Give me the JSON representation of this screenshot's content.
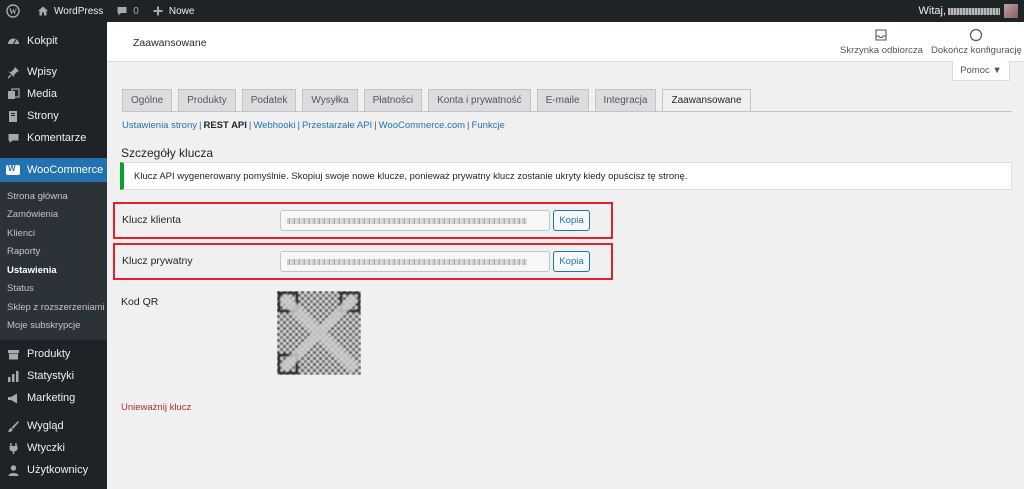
{
  "admin_bar": {
    "site_name": "WordPress",
    "comments_count": "0",
    "new_label": "Nowe",
    "greeting": "Witaj,"
  },
  "sidebar": {
    "top_items": [
      {
        "label": "Kokpit",
        "icon": "dashboard-icon"
      },
      {
        "label": "Wpisy",
        "icon": "pin-icon"
      },
      {
        "label": "Media",
        "icon": "media-icon"
      },
      {
        "label": "Strony",
        "icon": "page-icon"
      },
      {
        "label": "Komentarze",
        "icon": "comment-icon"
      }
    ],
    "woocommerce_label": "WooCommerce",
    "submenu": [
      "Strona główna",
      "Zamówienia",
      "Klienci",
      "Raporty",
      "Ustawienia",
      "Status",
      "Sklep z rozszerzeniami",
      "Moje subskrypcje"
    ],
    "bottom_items": [
      {
        "label": "Produkty",
        "icon": "archive-icon"
      },
      {
        "label": "Statystyki",
        "icon": "bar-chart-icon"
      },
      {
        "label": "Marketing",
        "icon": "megaphone-icon"
      },
      {
        "label": "Wygląd",
        "icon": "brush-icon"
      },
      {
        "label": "Wtyczki",
        "icon": "plug-icon"
      },
      {
        "label": "Użytkownicy",
        "icon": "user-icon"
      }
    ]
  },
  "header": {
    "title": "Zaawansowane",
    "inbox_label": "Skrzynka odbiorcza",
    "setup_label": "Dokończ konfigurację",
    "help_label": "Pomoc ▼"
  },
  "tabs": [
    "Ogólne",
    "Produkty",
    "Podatek",
    "Wysyłka",
    "Płatności",
    "Konta i prywatność",
    "E-maile",
    "Integracja",
    "Zaawansowane"
  ],
  "subnav": [
    "Ustawienia strony",
    "REST API",
    "Webhooki",
    "Przestarzałe API",
    "WooCommerce.com",
    "Funkcje"
  ],
  "section_title": "Szczegóły klucza",
  "notice_text": "Klucz API wygenerowany pomyślnie. Skopiuj swoje nowe klucze, ponieważ prywatny klucz zostanie ukryty kiedy opuścisz tę stronę.",
  "consumer_key": {
    "label": "Klucz klienta",
    "copy_label": "Kopia"
  },
  "consumer_secret": {
    "label": "Klucz prywatny",
    "copy_label": "Kopia"
  },
  "qr_label": "Kod QR",
  "revoke_label": "Unieważnij klucz",
  "colors": {
    "accent": "#2271b1",
    "admin_dark": "#1d2327",
    "success": "#00a32a",
    "highlight_box": "#e2212a",
    "danger_link": "#b32d2e"
  }
}
